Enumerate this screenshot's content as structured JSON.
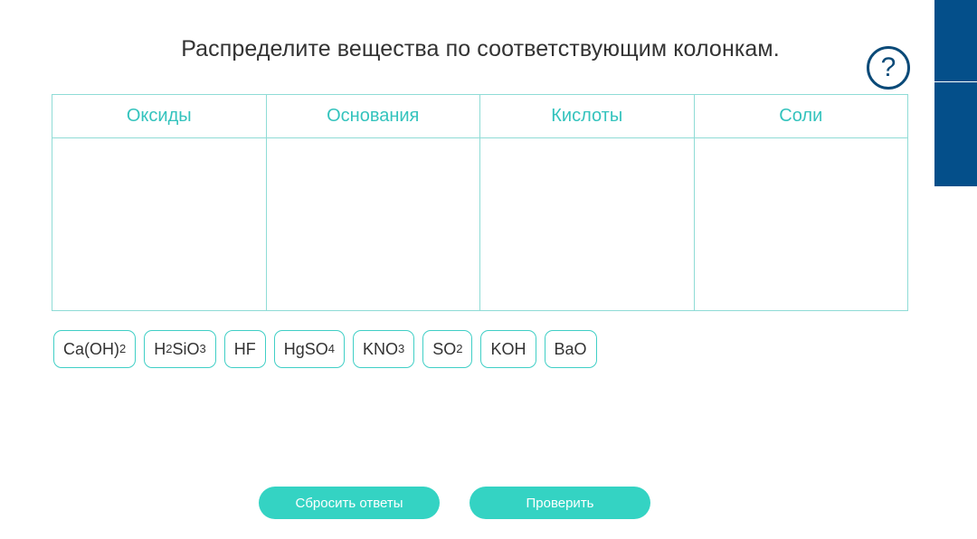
{
  "title": "Распределите вещества по соответствующим колонкам.",
  "help_label": "?",
  "columns": [
    {
      "label": "Оксиды"
    },
    {
      "label": "Основания"
    },
    {
      "label": "Кислоты"
    },
    {
      "label": "Соли"
    }
  ],
  "chips": [
    {
      "parts": [
        {
          "t": "Ca(OH)"
        },
        {
          "s": "2"
        }
      ]
    },
    {
      "parts": [
        {
          "t": "H"
        },
        {
          "s": "2"
        },
        {
          "t": "SiO"
        },
        {
          "s": "3"
        }
      ]
    },
    {
      "parts": [
        {
          "t": "HF"
        }
      ]
    },
    {
      "parts": [
        {
          "t": "HgSO"
        },
        {
          "s": "4"
        }
      ]
    },
    {
      "parts": [
        {
          "t": "KNO"
        },
        {
          "s": "3"
        }
      ]
    },
    {
      "parts": [
        {
          "t": "SO"
        },
        {
          "s": "2"
        }
      ]
    },
    {
      "parts": [
        {
          "t": "KOH"
        }
      ]
    },
    {
      "parts": [
        {
          "t": "BaO"
        }
      ]
    }
  ],
  "buttons": {
    "reset": "Сбросить ответы",
    "check": "Проверить"
  },
  "colors": {
    "accent": "#34d3c3",
    "header_text": "#34c3bd",
    "border": "#8fdcd6",
    "side_tab": "#044f8a",
    "help_icon": "#0b4a78"
  },
  "icons": {
    "help": "question-circle-icon"
  }
}
